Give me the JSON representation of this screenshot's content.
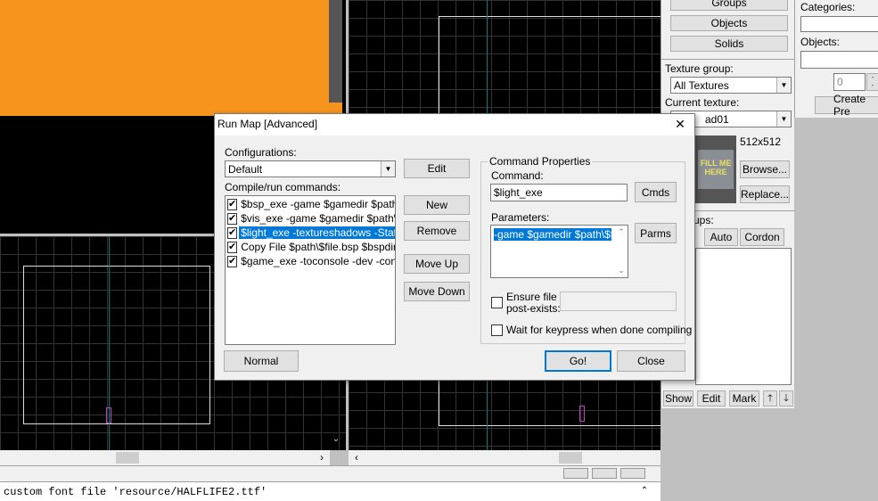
{
  "right_panel": {
    "groups_button": "Groups",
    "objects_button": "Objects",
    "solids_button": "Solids",
    "categories_label": "Categories:",
    "objects_label": "Objects:",
    "spin_value": "0",
    "create_prefab_button": "Create Pre",
    "texture_group_label": "Texture group:",
    "texture_group_value": "All Textures",
    "current_texture_label": "Current texture:",
    "current_texture_value": "ad01",
    "texture_size": "512x512",
    "texture_preview_text": "FILL ME HERE",
    "browse_button": "Browse...",
    "replace_button": "Replace...",
    "visgroups_label": "ups:",
    "auto_button": "Auto",
    "cordon_button": "Cordon",
    "show_button": "Show",
    "edit_button": "Edit",
    "mark_button": "Mark",
    "up_icon": "up-arrow-icon",
    "down_icon": "down-arrow-icon"
  },
  "console": {
    "line1": "custom font file 'resource/HALFLIFE2.ttf'"
  },
  "dialog": {
    "title": "Run Map [Advanced]",
    "close_glyph": "✕",
    "configurations_label": "Configurations:",
    "configuration_value": "Default",
    "compile_label": "Compile/run commands:",
    "commands": [
      {
        "checked": true,
        "text": "$bsp_exe -game $gamedir $path\\$file",
        "selected": false
      },
      {
        "checked": true,
        "text": "$vis_exe -game $gamedir $path\\$file",
        "selected": false
      },
      {
        "checked": true,
        "text": "$light_exe -textureshadows -StaticPro",
        "selected": true
      },
      {
        "checked": true,
        "text": "Copy File $path\\$file.bsp $bspdir\\$file",
        "selected": false
      },
      {
        "checked": true,
        "text": "$game_exe -toconsole -dev -console",
        "selected": false
      }
    ],
    "edit_button": "Edit",
    "new_button": "New",
    "remove_button": "Remove",
    "move_up_button": "Move Up",
    "move_down_button": "Move Down",
    "normal_button": "Normal",
    "command_properties_label": "Command Properties",
    "command_label": "Command:",
    "command_value": "$light_exe",
    "cmds_button": "Cmds",
    "parameters_label": "Parameters:",
    "parameters_value": "-game $gamedir $path\\$file",
    "parms_button": "Parms",
    "ensure_file_label_1": "Ensure file",
    "ensure_file_label_2": "post-exists:",
    "wait_keypress_label": "Wait for keypress when done compiling",
    "go_button": "Go!",
    "close_button": "Close"
  },
  "colors": {
    "orange": "#f7941d",
    "selection": "#0078d7",
    "grid_cyan": "#008080"
  }
}
